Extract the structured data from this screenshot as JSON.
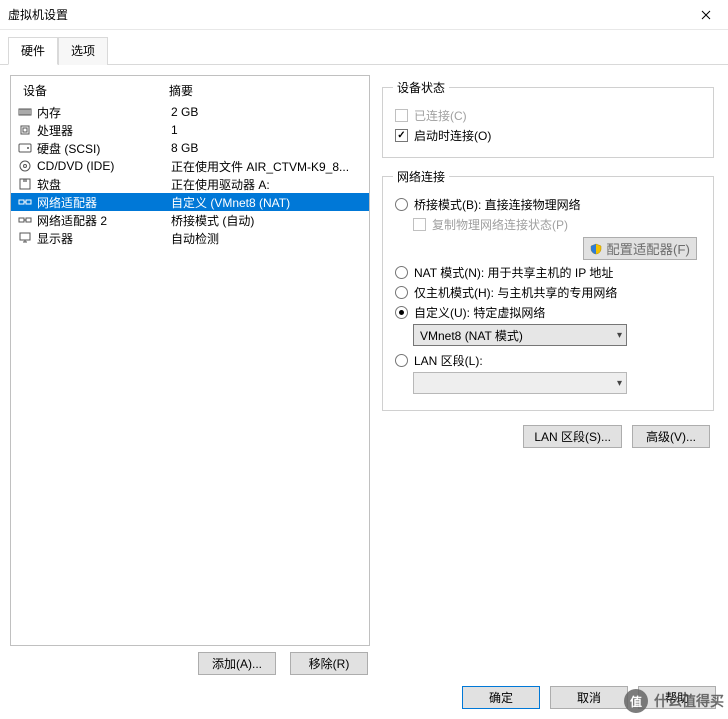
{
  "title": "虚拟机设置",
  "tabs": {
    "hardware": "硬件",
    "options": "选项"
  },
  "headers": {
    "device": "设备",
    "summary": "摘要"
  },
  "devices": [
    {
      "icon": "memory-icon",
      "name": "内存",
      "summary": "2 GB"
    },
    {
      "icon": "cpu-icon",
      "name": "处理器",
      "summary": "1"
    },
    {
      "icon": "disk-icon",
      "name": "硬盘 (SCSI)",
      "summary": "8 GB"
    },
    {
      "icon": "cd-icon",
      "name": "CD/DVD (IDE)",
      "summary": "正在使用文件 AIR_CTVM-K9_8..."
    },
    {
      "icon": "floppy-icon",
      "name": "软盘",
      "summary": "正在使用驱动器 A:"
    },
    {
      "icon": "net-icon",
      "name": "网络适配器",
      "summary": "自定义 (VMnet8 (NAT)",
      "selected": true
    },
    {
      "icon": "net-icon",
      "name": "网络适配器 2",
      "summary": "桥接模式 (自动)"
    },
    {
      "icon": "display-icon",
      "name": "显示器",
      "summary": "自动检测"
    }
  ],
  "left_buttons": {
    "add": "添加(A)...",
    "remove": "移除(R)"
  },
  "status_group": {
    "legend": "设备状态",
    "connected": "已连接(C)",
    "connect_at_poweron": "启动时连接(O)"
  },
  "net_group": {
    "legend": "网络连接",
    "bridged": "桥接模式(B): 直接连接物理网络",
    "replicate": "复制物理网络连接状态(P)",
    "configure": "配置适配器(F)",
    "nat": "NAT 模式(N): 用于共享主机的 IP 地址",
    "hostonly": "仅主机模式(H): 与主机共享的专用网络",
    "custom": "自定义(U): 特定虚拟网络",
    "custom_value": "VMnet8 (NAT 模式)",
    "lanseg": "LAN 区段(L):"
  },
  "right_buttons": {
    "lanseg": "LAN 区段(S)...",
    "advanced": "高级(V)..."
  },
  "footer": {
    "ok": "确定",
    "cancel": "取消",
    "help": "帮助"
  },
  "watermark": {
    "icon": "值",
    "text": "什么值得买"
  }
}
